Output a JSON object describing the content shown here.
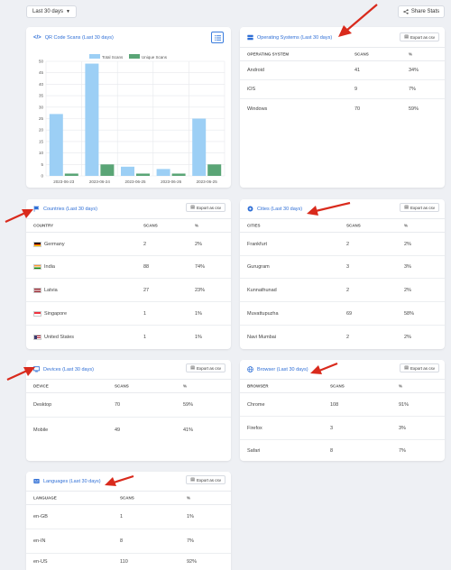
{
  "toolbar": {
    "range": "Last 30 days",
    "share": "Share Stats"
  },
  "export_label": "Export as csv",
  "qr": {
    "title": "QR Code Scans (Last 30 days)",
    "legend": [
      "Total Scans",
      "Unique Scans"
    ],
    "colors": {
      "total": "#9ccff5",
      "unique": "#5aa576"
    }
  },
  "chart_data": {
    "type": "bar",
    "title": "QR Code Scans (Last 30 days)",
    "categories": [
      "2023-06-23",
      "2023-06-24",
      "2023-06-25",
      "2023-06-26",
      "2023-06-25"
    ],
    "series": [
      {
        "name": "Total Scans",
        "values": [
          27,
          49,
          4,
          3,
          25
        ]
      },
      {
        "name": "Unique Scans",
        "values": [
          1,
          5,
          1,
          1,
          5
        ]
      }
    ],
    "ylim": [
      0,
      50
    ],
    "yticks": [
      "0",
      "5",
      "10",
      "15",
      "20",
      "25",
      "30",
      "35",
      "40",
      "45",
      "50"
    ],
    "legend": "top",
    "grid": true
  },
  "os": {
    "title": "Operating Systems (Last 30 days)",
    "headers": [
      "OPERATING SYSTEM",
      "SCANS",
      "%"
    ],
    "rows": [
      [
        "Android",
        "41",
        "34%"
      ],
      [
        "iOS",
        "9",
        "7%"
      ],
      [
        "Windows",
        "70",
        "59%"
      ]
    ]
  },
  "countries": {
    "title": "Countries (Last 30 days)",
    "headers": [
      "COUNTRY",
      "SCANS",
      "%"
    ],
    "rows": [
      [
        "Germany",
        "2",
        "2%"
      ],
      [
        "India",
        "88",
        "74%"
      ],
      [
        "Latvia",
        "27",
        "23%"
      ],
      [
        "Singapore",
        "1",
        "1%"
      ],
      [
        "United States",
        "1",
        "1%"
      ]
    ]
  },
  "cities": {
    "title": "Cities (Last 30 days)",
    "headers": [
      "CITIES",
      "SCANS",
      "%"
    ],
    "rows": [
      [
        "Frankfurt",
        "2",
        "2%"
      ],
      [
        "Gurugram",
        "3",
        "3%"
      ],
      [
        "Kunnathunad",
        "2",
        "2%"
      ],
      [
        "Muvattupuzha",
        "69",
        "58%"
      ],
      [
        "Navi Mumbai",
        "2",
        "2%"
      ]
    ]
  },
  "devices": {
    "title": "Devices (Last 30 days)",
    "headers": [
      "DEVICE",
      "SCANS",
      "%"
    ],
    "rows": [
      [
        "Desktop",
        "70",
        "59%"
      ],
      [
        "Mobile",
        "49",
        "41%"
      ]
    ]
  },
  "browser": {
    "title": "Browser (Last 30 days)",
    "headers": [
      "BROWSER",
      "SCANS",
      "%"
    ],
    "rows": [
      [
        "Chrome",
        "108",
        "91%"
      ],
      [
        "Firefox",
        "3",
        "3%"
      ],
      [
        "Safari",
        "8",
        "7%"
      ]
    ]
  },
  "languages": {
    "title": "Languages (Last 30 days)",
    "headers": [
      "LANGUAGE",
      "SCANS",
      "%"
    ],
    "rows": [
      [
        "en-GB",
        "1",
        "1%"
      ],
      [
        "en-IN",
        "8",
        "7%"
      ],
      [
        "en-US",
        "110",
        "92%"
      ]
    ]
  }
}
